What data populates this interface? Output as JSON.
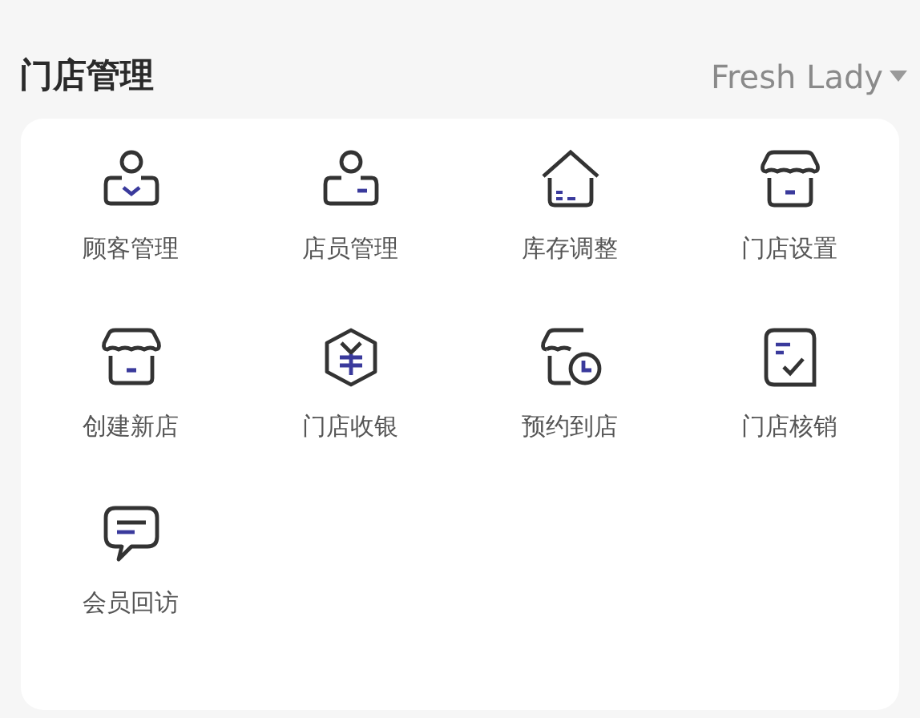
{
  "header": {
    "title": "门店管理",
    "store_selector": "Fresh Lady"
  },
  "items": [
    {
      "label": "顾客管理",
      "kind": "customer"
    },
    {
      "label": "店员管理",
      "kind": "clerk"
    },
    {
      "label": "库存调整",
      "kind": "house"
    },
    {
      "label": "门店设置",
      "kind": "store"
    },
    {
      "label": "创建新店",
      "kind": "store"
    },
    {
      "label": "门店收银",
      "kind": "cashier"
    },
    {
      "label": "预约到店",
      "kind": "appointment"
    },
    {
      "label": "门店核销",
      "kind": "checklist"
    },
    {
      "label": "会员回访",
      "kind": "chat"
    }
  ]
}
